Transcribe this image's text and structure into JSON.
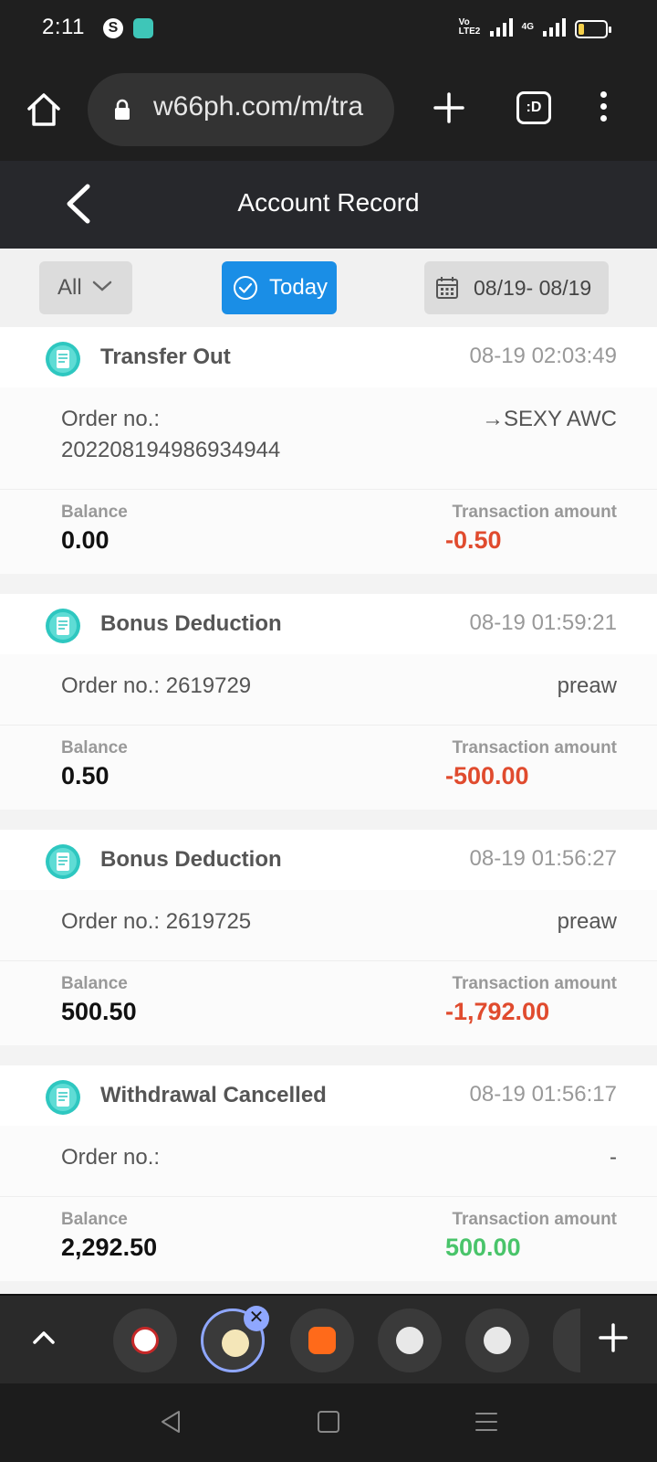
{
  "status_bar": {
    "time": "2:11",
    "app_icon_1": "s-circle-icon",
    "network": "4G",
    "volte": "Vo LTE2"
  },
  "browser": {
    "url": "w66ph.com/m/tra",
    "tabs_label": ":D"
  },
  "header": {
    "title": "Account Record"
  },
  "filters": {
    "type_label": "All",
    "today_label": "Today",
    "date_range": "08/19- 08/19"
  },
  "records": [
    {
      "type": "Transfer Out",
      "time": "08-19 02:03:49",
      "order_label": "Order no.:",
      "order_value": "202208194986934944",
      "destination": "→SEXY AWC",
      "balance_label": "Balance",
      "balance": "0.00",
      "amount_label": "Transaction amount",
      "amount": "-0.50",
      "amount_sign": "negative"
    },
    {
      "type": "Bonus Deduction",
      "time": "08-19 01:59:21",
      "order_label": "Order no.:",
      "order_value": "2619729",
      "destination": "preaw",
      "balance_label": "Balance",
      "balance": "0.50",
      "amount_label": "Transaction amount",
      "amount": "-500.00",
      "amount_sign": "negative"
    },
    {
      "type": "Bonus Deduction",
      "time": "08-19 01:56:27",
      "order_label": "Order no.:",
      "order_value": "2619725",
      "destination": "preaw",
      "balance_label": "Balance",
      "balance": "500.50",
      "amount_label": "Transaction amount",
      "amount": "-1,792.00",
      "amount_sign": "negative"
    },
    {
      "type": "Withdrawal Cancelled",
      "time": "08-19 01:56:17",
      "order_label": "Order no.:",
      "order_value": "",
      "destination": "-",
      "balance_label": "Balance",
      "balance": "2,292.50",
      "amount_label": "Transaction amount",
      "amount": "500.00",
      "amount_sign": "positive"
    }
  ],
  "colors": {
    "accent": "#1a8ee6",
    "negative": "#e04b2e",
    "positive": "#49c46a",
    "record_icon": "#2ec7c0"
  }
}
